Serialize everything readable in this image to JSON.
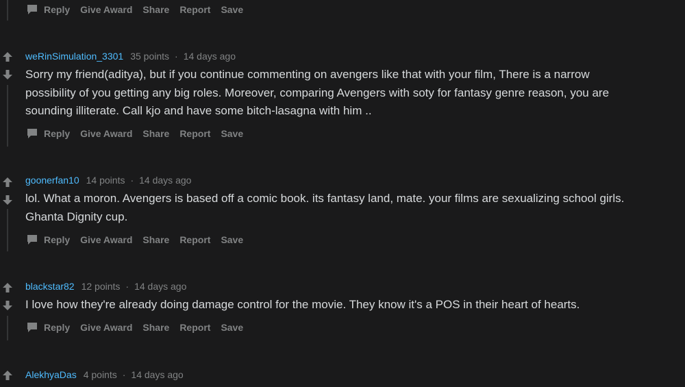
{
  "actions": {
    "reply": "Reply",
    "give_award": "Give Award",
    "share": "Share",
    "report": "Report",
    "save": "Save"
  },
  "comments": [
    {
      "author": "weRinSimulation_3301",
      "points": "35 points",
      "separator": "·",
      "time": "14 days ago",
      "lines": [
        "Sorry my friend(aditya), but if you continue commenting on avengers like that with your film, There is a narrow",
        "possibility of you getting any big roles. Moreover, comparing Avengers with soty for fantasy genre reason, you are",
        "sounding illiterate. Call kjo and have some bitch-lasagna with him .."
      ]
    },
    {
      "author": "goonerfan10",
      "points": "14 points",
      "separator": "·",
      "time": "14 days ago",
      "lines": [
        "lol. What a moron. Avengers is based off a comic book. its fantasy land, mate. your films are sexualizing school girls.",
        "Ghanta Dignity cup."
      ]
    },
    {
      "author": "blackstar82",
      "points": "12 points",
      "separator": "·",
      "time": "14 days ago",
      "lines": [
        "I love how they're already doing damage control for the movie. They know it's a POS in their heart of hearts."
      ]
    },
    {
      "author": "AlekhyaDas",
      "points": "4 points",
      "separator": "·",
      "time": "14 days ago",
      "lines": []
    }
  ],
  "colors": {
    "background": "#1a1a1b",
    "author": "#4fbcff",
    "meta": "#818384",
    "body": "#d7dadc",
    "thread_line": "#343536"
  },
  "icons": {
    "upvote": "arrow-up-icon",
    "downvote": "arrow-down-icon",
    "reply": "speech-bubble-icon"
  }
}
